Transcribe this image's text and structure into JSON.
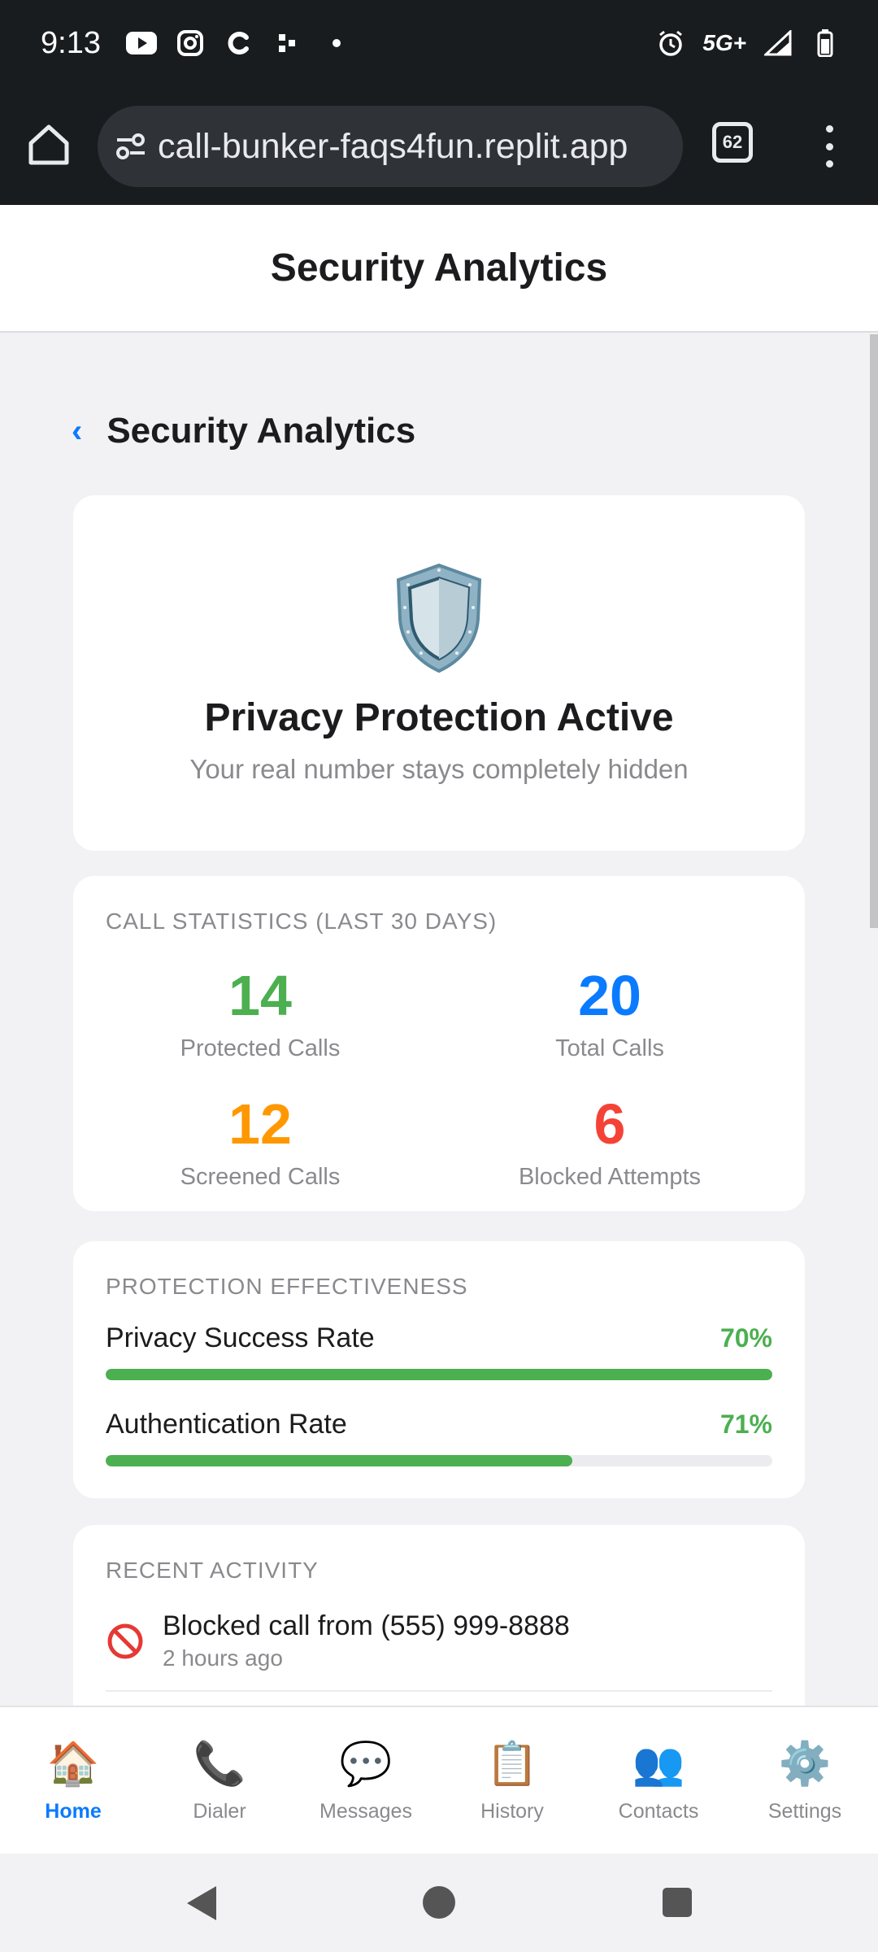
{
  "status_bar": {
    "time": "9:13",
    "left_icons": [
      "youtube-icon",
      "instagram-icon",
      "c-app-icon",
      "dots-app-icon",
      "notification-dot-icon"
    ],
    "network": "5G+",
    "right_icons": [
      "alarm-icon",
      "signal-icon",
      "battery-icon"
    ]
  },
  "browser": {
    "url": "call-bunker-faqs4fun.replit.app",
    "tab_count": "62"
  },
  "header": {
    "title": "Security Analytics"
  },
  "page": {
    "back_chevron": "‹",
    "title": "Security Analytics"
  },
  "hero": {
    "icon": "shield-icon",
    "title": "Privacy Protection Active",
    "subtitle": "Your real number stays completely hidden"
  },
  "stats": {
    "section_label": "CALL STATISTICS (LAST 30 DAYS)",
    "items": [
      {
        "value": "14",
        "label": "Protected Calls",
        "color": "#4caf50"
      },
      {
        "value": "20",
        "label": "Total Calls",
        "color": "#0a7bff"
      },
      {
        "value": "12",
        "label": "Screened Calls",
        "color": "#ff9800"
      },
      {
        "value": "6",
        "label": "Blocked Attempts",
        "color": "#f44336"
      }
    ]
  },
  "effectiveness": {
    "section_label": "PROTECTION EFFECTIVENESS",
    "rates": [
      {
        "label": "Privacy Success Rate",
        "value": "70%",
        "fill": 1.0
      },
      {
        "label": "Authentication Rate",
        "value": "71%",
        "fill": 0.7
      }
    ]
  },
  "activity": {
    "section_label": "RECENT ACTIVITY",
    "items": [
      {
        "icon": "blocked-icon",
        "text": "Blocked call from (555) 999-8888",
        "time": "2 hours ago"
      }
    ]
  },
  "nav": {
    "items": [
      {
        "icon": "🏠",
        "label": "Home",
        "active": true
      },
      {
        "icon": "📞",
        "label": "Dialer",
        "active": false
      },
      {
        "icon": "💬",
        "label": "Messages",
        "active": false
      },
      {
        "icon": "📋",
        "label": "History",
        "active": false
      },
      {
        "icon": "👥",
        "label": "Contacts",
        "active": false
      },
      {
        "icon": "⚙️",
        "label": "Settings",
        "active": false
      }
    ]
  },
  "colors": {
    "accent": "#0a7bff",
    "success": "#4caf50",
    "warning": "#ff9800",
    "danger": "#f44336"
  }
}
